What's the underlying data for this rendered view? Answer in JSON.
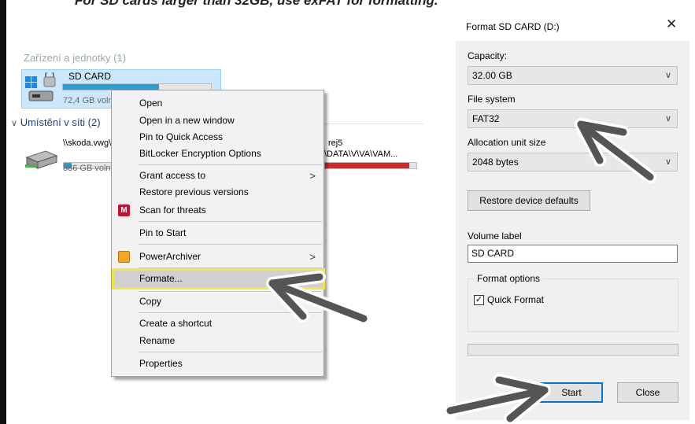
{
  "caption": "For SD cards larger than 32GB, use exFAT for formatting.",
  "explorer": {
    "devices_group": "Zařízení a jednotky (1)",
    "network_group": "Umístění v síti (2)",
    "sd_card": {
      "name": "SD CARD",
      "free": "72,4 GB volných",
      "used_fraction": 0.65,
      "bar_color": "#26a0da"
    },
    "network_drive": {
      "name": "\\\\skoda.vwg\\...",
      "free": "386 GB volných",
      "used_fraction": 0.15,
      "bar_color": "#26a0da"
    },
    "network_drive_2": {
      "name": "rej5",
      "path": "\\DATA\\V\\VA\\VAM...",
      "used_fraction": 0.92,
      "bar_color": "#da2626"
    }
  },
  "context_menu": {
    "items": [
      {
        "label": "Open"
      },
      {
        "label": "Open in a new window"
      },
      {
        "label": "Pin to Quick Access"
      },
      {
        "label": "BitLocker Encryption Options"
      },
      {
        "label": "Grant access to",
        "submenu": true
      },
      {
        "label": "Restore previous versions"
      },
      {
        "label": "Scan for threats",
        "icon": "mcafee-shield-icon"
      },
      {
        "label": "Pin to Start"
      },
      {
        "label": "PowerArchiver",
        "icon": "powerarchiver-icon",
        "submenu": true
      },
      {
        "label": "Formate..."
      },
      {
        "label": "Copy"
      },
      {
        "label": "Create a shortcut"
      },
      {
        "label": "Rename"
      },
      {
        "label": "Properties"
      }
    ]
  },
  "format_dialog": {
    "title": "Format SD CARD (D:)",
    "close_glyph": "✕",
    "capacity_label": "Capacity:",
    "capacity_value": "32.00 GB",
    "filesystem_label": "File system",
    "filesystem_value": "FAT32",
    "allocation_label": "Allocation unit size",
    "allocation_value": "2048 bytes",
    "restore_button": "Restore device defaults",
    "volume_label": "Volume label",
    "volume_value": "SD CARD",
    "format_options_label": "Format options",
    "quick_format_label": "Quick Format",
    "quick_format_checked": "✓",
    "progress": 0,
    "start_button": "Start",
    "close_button": "Close"
  },
  "annotation_color": "#555555"
}
